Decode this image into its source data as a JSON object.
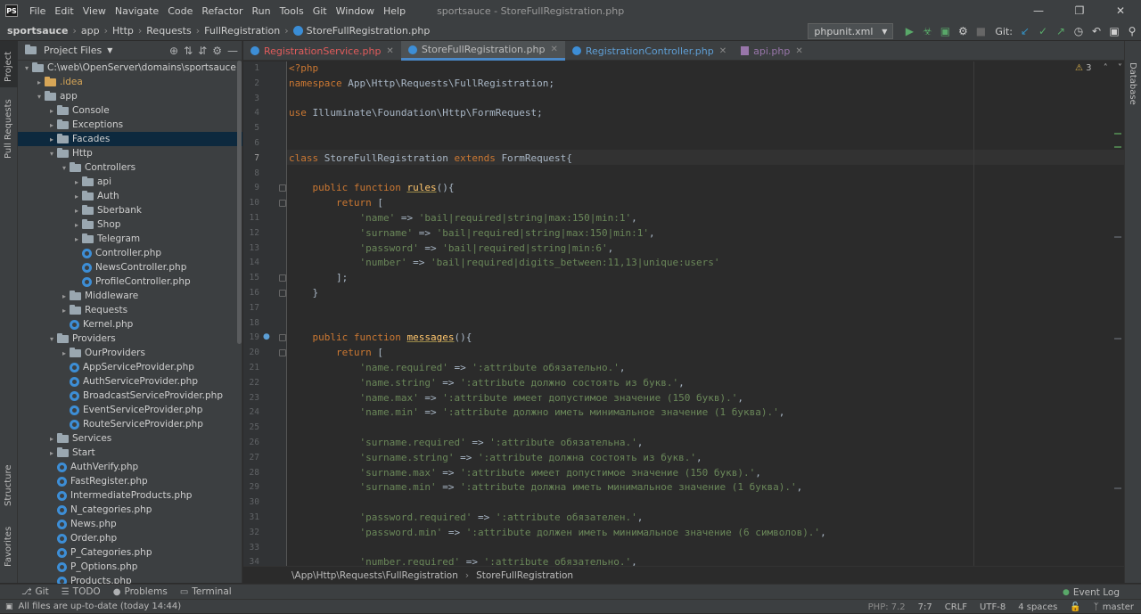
{
  "app": {
    "logo_text": "PS",
    "window_title": "sportsauce - StoreFullRegistration.php",
    "menu": [
      "File",
      "Edit",
      "View",
      "Navigate",
      "Code",
      "Refactor",
      "Run",
      "Tools",
      "Git",
      "Window",
      "Help"
    ]
  },
  "navbar": {
    "crumbs": [
      "sportsauce",
      "app",
      "Http",
      "Requests",
      "FullRegistration",
      "StoreFullRegistration.php"
    ],
    "run_config": "phpunit.xml",
    "git_label": "Git:"
  },
  "left_strip": {
    "project": "Project",
    "pull_requests": "Pull Requests",
    "structure": "Structure",
    "favorites": "Favorites"
  },
  "right_strip": {
    "database": "Database"
  },
  "project_panel": {
    "title": "Project Files",
    "tree": [
      {
        "depth": 0,
        "type": "folder",
        "label": "C:\\web\\OpenServer\\domains\\sportsauce",
        "open": true
      },
      {
        "depth": 1,
        "type": "folder-y",
        "label": ".idea",
        "open": false
      },
      {
        "depth": 1,
        "type": "folder",
        "label": "app",
        "open": true
      },
      {
        "depth": 2,
        "type": "folder",
        "label": "Console",
        "open": false
      },
      {
        "depth": 2,
        "type": "folder",
        "label": "Exceptions",
        "open": false
      },
      {
        "depth": 2,
        "type": "folder",
        "label": "Facades",
        "open": false,
        "selected": true
      },
      {
        "depth": 2,
        "type": "folder",
        "label": "Http",
        "open": true
      },
      {
        "depth": 3,
        "type": "folder",
        "label": "Controllers",
        "open": true
      },
      {
        "depth": 4,
        "type": "folder",
        "label": "api",
        "open": false
      },
      {
        "depth": 4,
        "type": "folder",
        "label": "Auth",
        "open": false
      },
      {
        "depth": 4,
        "type": "folder",
        "label": "Sberbank",
        "open": false
      },
      {
        "depth": 4,
        "type": "folder",
        "label": "Shop",
        "open": false
      },
      {
        "depth": 4,
        "type": "folder",
        "label": "Telegram",
        "open": false
      },
      {
        "depth": 4,
        "type": "php",
        "label": "Controller.php"
      },
      {
        "depth": 4,
        "type": "php",
        "label": "NewsController.php"
      },
      {
        "depth": 4,
        "type": "php",
        "label": "ProfileController.php"
      },
      {
        "depth": 3,
        "type": "folder",
        "label": "Middleware",
        "open": false
      },
      {
        "depth": 3,
        "type": "folder",
        "label": "Requests",
        "open": false
      },
      {
        "depth": 3,
        "type": "php",
        "label": "Kernel.php"
      },
      {
        "depth": 2,
        "type": "folder",
        "label": "Providers",
        "open": true
      },
      {
        "depth": 3,
        "type": "folder",
        "label": "OurProviders",
        "open": false
      },
      {
        "depth": 3,
        "type": "php",
        "label": "AppServiceProvider.php"
      },
      {
        "depth": 3,
        "type": "php",
        "label": "AuthServiceProvider.php"
      },
      {
        "depth": 3,
        "type": "php",
        "label": "BroadcastServiceProvider.php"
      },
      {
        "depth": 3,
        "type": "php",
        "label": "EventServiceProvider.php"
      },
      {
        "depth": 3,
        "type": "php",
        "label": "RouteServiceProvider.php"
      },
      {
        "depth": 2,
        "type": "folder",
        "label": "Services",
        "open": false
      },
      {
        "depth": 2,
        "type": "folder",
        "label": "Start",
        "open": false
      },
      {
        "depth": 2,
        "type": "php",
        "label": "AuthVerify.php"
      },
      {
        "depth": 2,
        "type": "php",
        "label": "FastRegister.php"
      },
      {
        "depth": 2,
        "type": "php",
        "label": "IntermediateProducts.php"
      },
      {
        "depth": 2,
        "type": "php",
        "label": "N_categories.php"
      },
      {
        "depth": 2,
        "type": "php",
        "label": "News.php"
      },
      {
        "depth": 2,
        "type": "php",
        "label": "Order.php"
      },
      {
        "depth": 2,
        "type": "php",
        "label": "P_Categories.php"
      },
      {
        "depth": 2,
        "type": "php",
        "label": "P_Options.php"
      },
      {
        "depth": 2,
        "type": "php",
        "label": "Products.php"
      }
    ]
  },
  "tabs": [
    {
      "label": "RegistrationService.php",
      "kind": "err"
    },
    {
      "label": "StoreFullRegistration.php",
      "kind": "active"
    },
    {
      "label": "RegistrationController.php",
      "kind": "f"
    },
    {
      "label": "api.php",
      "kind": "api"
    }
  ],
  "editor": {
    "warning_count": "3",
    "current_line": 7,
    "lines": [
      {
        "n": 1,
        "segs": [
          [
            "tag",
            "<?php"
          ]
        ]
      },
      {
        "n": 2,
        "segs": [
          [
            "kw",
            "namespace "
          ],
          [
            "cls",
            "App\\Http\\Requests\\FullRegistration;"
          ]
        ]
      },
      {
        "n": 3,
        "segs": []
      },
      {
        "n": 4,
        "segs": [
          [
            "kw",
            "use "
          ],
          [
            "cls",
            "Illuminate\\Foundation\\Http\\FormRequest;"
          ]
        ]
      },
      {
        "n": 5,
        "segs": []
      },
      {
        "n": 6,
        "segs": []
      },
      {
        "n": 7,
        "segs": [
          [
            "kw",
            "class "
          ],
          [
            "cls",
            "StoreFullRegistration "
          ],
          [
            "kw",
            "extends "
          ],
          [
            "cls",
            "FormRequest{"
          ]
        ]
      },
      {
        "n": 8,
        "segs": []
      },
      {
        "n": 9,
        "segs": [
          [
            "cls",
            "    "
          ],
          [
            "kw",
            "public function "
          ],
          [
            "fnu",
            "rules"
          ],
          [
            "cls",
            "(){"
          ]
        ]
      },
      {
        "n": 10,
        "segs": [
          [
            "cls",
            "        "
          ],
          [
            "kw",
            "return "
          ],
          [
            "cls",
            "["
          ]
        ]
      },
      {
        "n": 11,
        "segs": [
          [
            "cls",
            "            "
          ],
          [
            "str",
            "'name'"
          ],
          [
            "cls",
            " => "
          ],
          [
            "str",
            "'bail|required|string|max:150|min:1'"
          ],
          [
            "cls",
            ","
          ]
        ]
      },
      {
        "n": 12,
        "segs": [
          [
            "cls",
            "            "
          ],
          [
            "str",
            "'surname'"
          ],
          [
            "cls",
            " => "
          ],
          [
            "str",
            "'bail|required|string|max:150|min:1'"
          ],
          [
            "cls",
            ","
          ]
        ]
      },
      {
        "n": 13,
        "segs": [
          [
            "cls",
            "            "
          ],
          [
            "str",
            "'password'"
          ],
          [
            "cls",
            " => "
          ],
          [
            "str",
            "'bail|required|string|min:6'"
          ],
          [
            "cls",
            ","
          ]
        ]
      },
      {
        "n": 14,
        "segs": [
          [
            "cls",
            "            "
          ],
          [
            "str",
            "'number'"
          ],
          [
            "cls",
            " => "
          ],
          [
            "str",
            "'bail|required|digits_between:11,13|unique:users'"
          ]
        ]
      },
      {
        "n": 15,
        "segs": [
          [
            "cls",
            "        ];"
          ]
        ]
      },
      {
        "n": 16,
        "segs": [
          [
            "cls",
            "    }"
          ]
        ]
      },
      {
        "n": 17,
        "segs": []
      },
      {
        "n": 18,
        "segs": []
      },
      {
        "n": 19,
        "segs": [
          [
            "cls",
            "    "
          ],
          [
            "kw",
            "public function "
          ],
          [
            "fnu",
            "messages"
          ],
          [
            "cls",
            "(){"
          ]
        ]
      },
      {
        "n": 20,
        "segs": [
          [
            "cls",
            "        "
          ],
          [
            "kw",
            "return "
          ],
          [
            "cls",
            "["
          ]
        ]
      },
      {
        "n": 21,
        "segs": [
          [
            "cls",
            "            "
          ],
          [
            "str",
            "'name.required'"
          ],
          [
            "cls",
            " => "
          ],
          [
            "str",
            "':attribute обязательно.'"
          ],
          [
            "cls",
            ","
          ]
        ]
      },
      {
        "n": 22,
        "segs": [
          [
            "cls",
            "            "
          ],
          [
            "str",
            "'name.string'"
          ],
          [
            "cls",
            " => "
          ],
          [
            "str",
            "':attribute должно состоять из букв.'"
          ],
          [
            "cls",
            ","
          ]
        ]
      },
      {
        "n": 23,
        "segs": [
          [
            "cls",
            "            "
          ],
          [
            "str",
            "'name.max'"
          ],
          [
            "cls",
            " => "
          ],
          [
            "str",
            "':attribute имеет допустимое значение (150 букв).'"
          ],
          [
            "cls",
            ","
          ]
        ]
      },
      {
        "n": 24,
        "segs": [
          [
            "cls",
            "            "
          ],
          [
            "str",
            "'name.min'"
          ],
          [
            "cls",
            " => "
          ],
          [
            "str",
            "':attribute должно иметь минимальное значение (1 буква).'"
          ],
          [
            "cls",
            ","
          ]
        ]
      },
      {
        "n": 25,
        "segs": []
      },
      {
        "n": 26,
        "segs": [
          [
            "cls",
            "            "
          ],
          [
            "str",
            "'surname.required'"
          ],
          [
            "cls",
            " => "
          ],
          [
            "str",
            "':attribute обязательна.'"
          ],
          [
            "cls",
            ","
          ]
        ]
      },
      {
        "n": 27,
        "segs": [
          [
            "cls",
            "            "
          ],
          [
            "str",
            "'surname.string'"
          ],
          [
            "cls",
            " => "
          ],
          [
            "str",
            "':attribute должна состоять из букв.'"
          ],
          [
            "cls",
            ","
          ]
        ]
      },
      {
        "n": 28,
        "segs": [
          [
            "cls",
            "            "
          ],
          [
            "str",
            "'surname.max'"
          ],
          [
            "cls",
            " => "
          ],
          [
            "str",
            "':attribute имеет допустимое значение (150 букв).'"
          ],
          [
            "cls",
            ","
          ]
        ]
      },
      {
        "n": 29,
        "segs": [
          [
            "cls",
            "            "
          ],
          [
            "str",
            "'surname.min'"
          ],
          [
            "cls",
            " => "
          ],
          [
            "str",
            "':attribute должна иметь минимальное значение (1 буква).'"
          ],
          [
            "cls",
            ","
          ]
        ]
      },
      {
        "n": 30,
        "segs": []
      },
      {
        "n": 31,
        "segs": [
          [
            "cls",
            "            "
          ],
          [
            "str",
            "'password.required'"
          ],
          [
            "cls",
            " => "
          ],
          [
            "str",
            "':attribute обязателен.'"
          ],
          [
            "cls",
            ","
          ]
        ]
      },
      {
        "n": 32,
        "segs": [
          [
            "cls",
            "            "
          ],
          [
            "str",
            "'password.min'"
          ],
          [
            "cls",
            " => "
          ],
          [
            "str",
            "':attribute должен иметь минимальное значение (6 символов).'"
          ],
          [
            "cls",
            ","
          ]
        ]
      },
      {
        "n": 33,
        "segs": []
      },
      {
        "n": 34,
        "segs": [
          [
            "cls",
            "            "
          ],
          [
            "str",
            "'number.required'"
          ],
          [
            "cls",
            " => "
          ],
          [
            "str",
            "':attribute обязательно.'"
          ],
          [
            "cls",
            ","
          ]
        ]
      }
    ]
  },
  "breadcrumb_bar": {
    "path": "\\App\\Http\\Requests\\FullRegistration",
    "class": "StoreFullRegistration"
  },
  "tool_windows": [
    {
      "icon": "git-icon",
      "glyph": "⎇",
      "label": "Git"
    },
    {
      "icon": "todo-icon",
      "glyph": "☰",
      "label": "TODO"
    },
    {
      "icon": "problems-icon",
      "glyph": "●",
      "label": "Problems"
    },
    {
      "icon": "terminal-icon",
      "glyph": "▭",
      "label": "Terminal"
    }
  ],
  "event_log": "Event Log",
  "status": {
    "message": "All files are up-to-date (today 14:44)",
    "php": "PHP: 7.2",
    "position": "7:7",
    "line_sep": "CRLF",
    "encoding": "UTF-8",
    "indent": "4 spaces",
    "branch": "master"
  }
}
